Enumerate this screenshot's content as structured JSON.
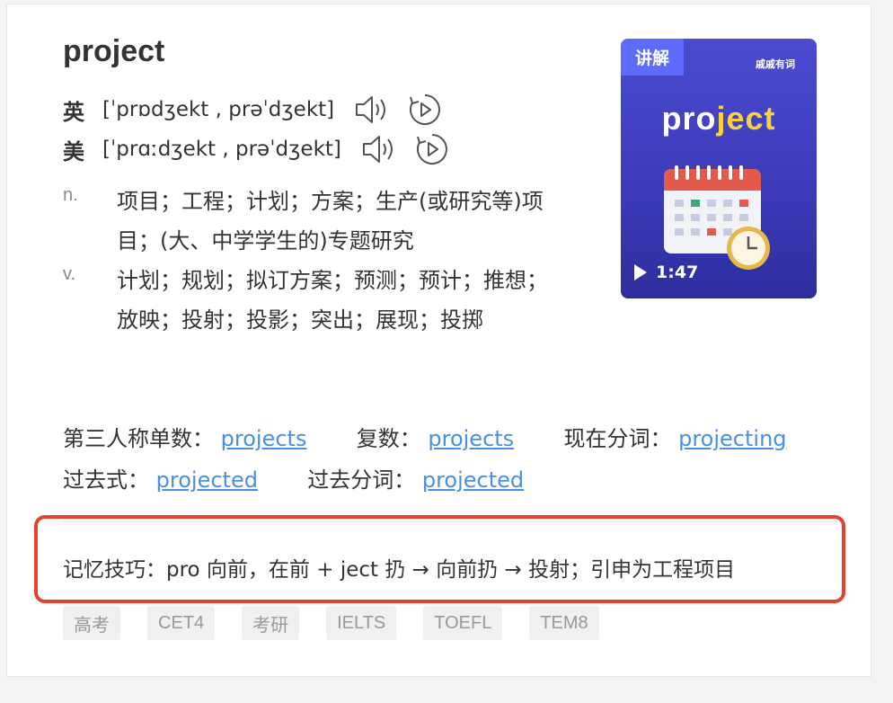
{
  "entry": {
    "word": "project",
    "pronunciations": [
      {
        "label": "英",
        "ipa": "[ˈprɒdʒekt , prəˈdʒekt]"
      },
      {
        "label": "美",
        "ipa": "[ˈprɑːdʒekt , prəˈdʒekt]"
      }
    ],
    "definitions": [
      {
        "pos": "n.",
        "text": "项目；工程；计划；方案；生产(或研究等)项目；(大、中学学生的)专题研究"
      },
      {
        "pos": "v.",
        "text": "计划；规划；拟订方案；预测；预计；推想；放映；投射；投影；突出；展现；投掷"
      }
    ]
  },
  "video": {
    "badge": "讲解",
    "brand": "戚戚有词",
    "word_a": "pro",
    "word_b": "ject",
    "duration": "1:47"
  },
  "forms": {
    "third_person_label": "第三人称单数：",
    "third_person_value": "projects",
    "plural_label": "复数：",
    "plural_value": "projects",
    "present_participle_label": "现在分词：",
    "present_participle_value": "projecting",
    "past_label": "过去式：",
    "past_value": "projected",
    "past_participle_label": "过去分词：",
    "past_participle_value": "projected"
  },
  "mnemonic": "记忆技巧：pro 向前，在前 + ject 扔 → 向前扔 → 投射；引申为工程项目",
  "tags": [
    "高考",
    "CET4",
    "考研",
    "IELTS",
    "TOEFL",
    "TEM8"
  ],
  "colors": {
    "link": "#4a90e2",
    "highlight_border": "#e3422e",
    "video_bg": "#3f40c0",
    "badge_bg": "#5d6bff"
  }
}
